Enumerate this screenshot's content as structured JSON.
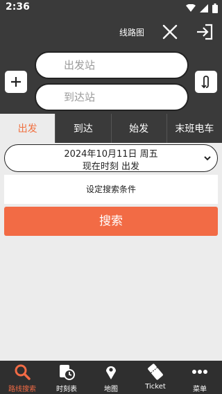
{
  "status": {
    "time": "2:36"
  },
  "header": {
    "title": "线路图"
  },
  "search": {
    "from_placeholder": "出发站",
    "to_placeholder": "到达站"
  },
  "tabs": [
    {
      "label": "出发",
      "active": true
    },
    {
      "label": "到达",
      "active": false
    },
    {
      "label": "始发",
      "active": false
    },
    {
      "label": "末班电车",
      "active": false
    }
  ],
  "date": {
    "line1": "2024年10月11日 周五",
    "line2": "现在时刻 出发"
  },
  "conditions_label": "设定搜索条件",
  "search_button": "搜索",
  "nav": [
    {
      "label": "路线搜索",
      "icon": "search-icon",
      "active": true
    },
    {
      "label": "时刻表",
      "icon": "timetable-icon",
      "active": false
    },
    {
      "label": "地图",
      "icon": "map-pin-icon",
      "active": false
    },
    {
      "label": "Ticket",
      "icon": "ticket-icon",
      "active": false
    },
    {
      "label": "菜单",
      "icon": "more-icon",
      "active": false
    }
  ],
  "colors": {
    "accent": "#f26b45",
    "dark": "#3a3a3a",
    "background": "#ececec"
  }
}
